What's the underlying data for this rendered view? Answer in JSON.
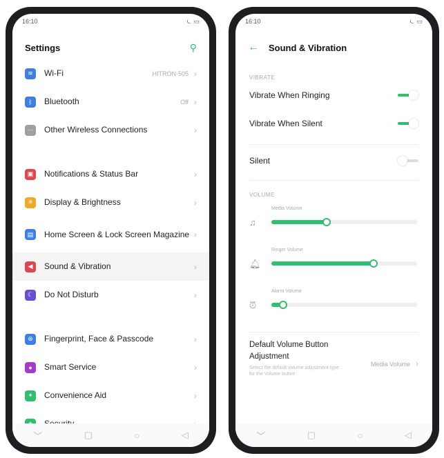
{
  "left": {
    "status": {
      "time": "16:10"
    },
    "header": {
      "title": "Settings"
    },
    "groups": [
      [
        {
          "label": "Wi-Fi",
          "value": "HITRON-505",
          "icon": "wifi-icon",
          "color": "#3f7fe3"
        },
        {
          "label": "Bluetooth",
          "value": "Off",
          "icon": "bluetooth-icon",
          "color": "#3f7fe3"
        },
        {
          "label": "Other Wireless Connections",
          "value": "",
          "icon": "wireless-icon",
          "color": "#a0a0a0"
        }
      ],
      [
        {
          "label": "Notifications & Status Bar",
          "value": "",
          "icon": "notifications-icon",
          "color": "#e0464e"
        },
        {
          "label": "Display & Brightness",
          "value": "",
          "icon": "brightness-icon",
          "color": "#f0a92a"
        },
        {
          "label": "Home Screen & Lock Screen Magazine",
          "value": "",
          "icon": "home-screen-icon",
          "color": "#3f7fe3"
        },
        {
          "label": "Sound & Vibration",
          "value": "",
          "icon": "sound-icon",
          "color": "#e0464e"
        },
        {
          "label": "Do Not Disturb",
          "value": "",
          "icon": "moon-icon",
          "color": "#6a4fd1"
        }
      ],
      [
        {
          "label": "Fingerprint, Face & Passcode",
          "value": "",
          "icon": "fingerprint-icon",
          "color": "#3f7fe3"
        },
        {
          "label": "Smart Service",
          "value": "",
          "icon": "smart-service-icon",
          "color": "#a63ac9"
        },
        {
          "label": "Convenience Aid",
          "value": "",
          "icon": "convenience-icon",
          "color": "#2fbf71"
        },
        {
          "label": "Security",
          "value": "",
          "icon": "shield-icon",
          "color": "#2fbf71"
        }
      ]
    ]
  },
  "right": {
    "status": {
      "time": "16:10"
    },
    "header": {
      "title": "Sound & Vibration"
    },
    "vibrate_section": "VIBRATE",
    "vibrate_when_ringing": {
      "label": "Vibrate When Ringing",
      "on": true
    },
    "vibrate_when_silent": {
      "label": "Vibrate When Silent",
      "on": true
    },
    "silent": {
      "label": "Silent",
      "on": false
    },
    "volume_section": "VOLUME",
    "volumes": [
      {
        "label": "Media Volume",
        "icon": "music-note-icon",
        "level": 0.38
      },
      {
        "label": "Ringer Volume",
        "icon": "bell-icon",
        "level": 0.7
      },
      {
        "label": "Alarm Volume",
        "icon": "alarm-icon",
        "level": 0.08
      }
    ],
    "default_volume": {
      "title": "Default Volume Button Adjustment",
      "subtitle": "Select the default volume adjustment type for the Volume button",
      "value": "Media Volume"
    }
  }
}
